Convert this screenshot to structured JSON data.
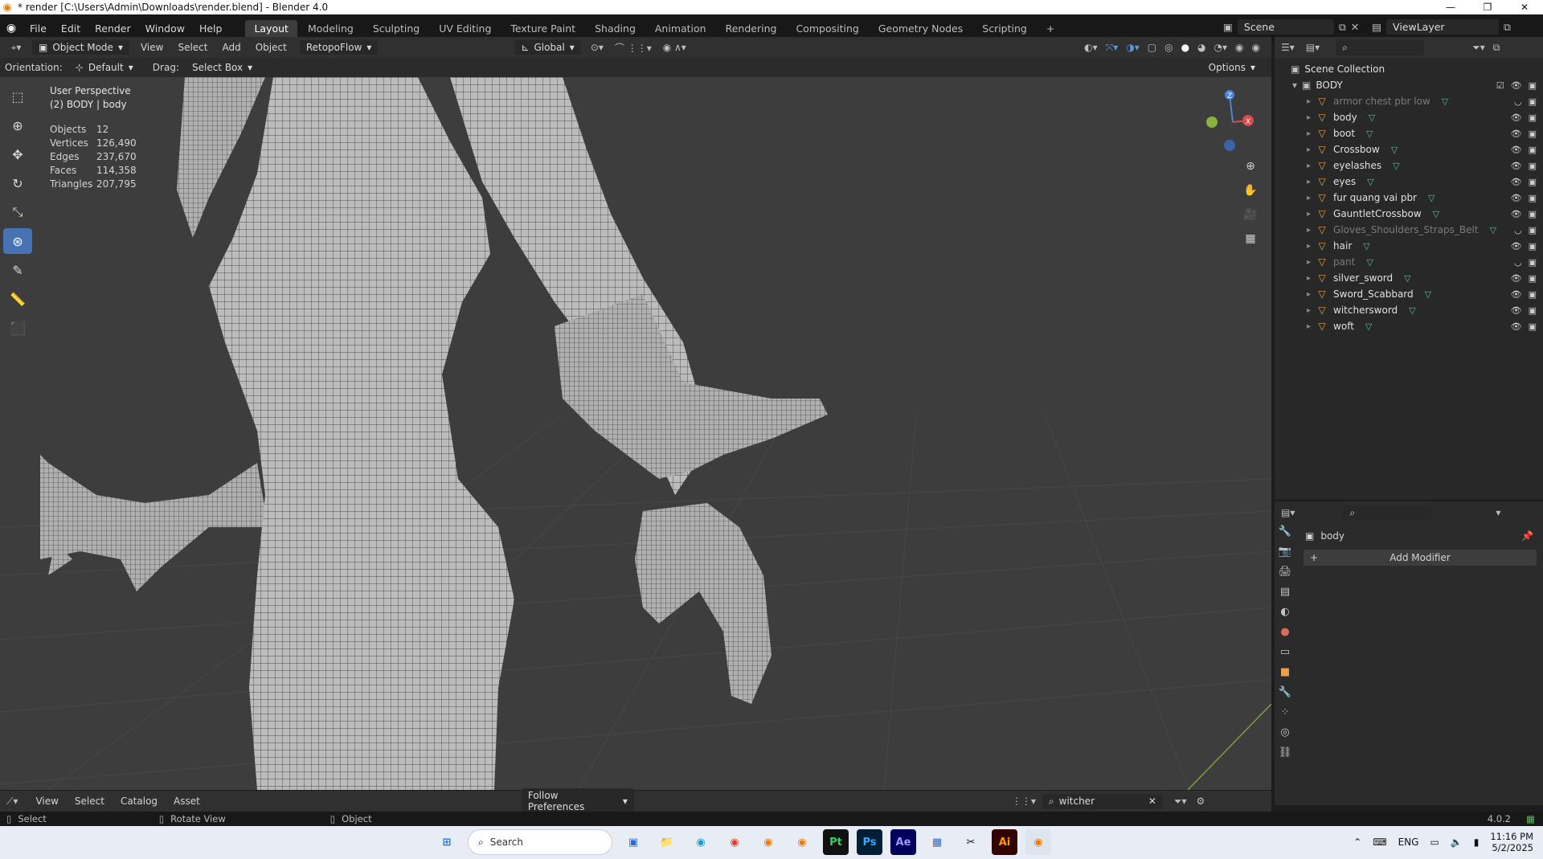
{
  "window": {
    "title": "* render [C:\\Users\\Admin\\Downloads\\render.blend] - Blender 4.0"
  },
  "menu": {
    "items": [
      "File",
      "Edit",
      "Render",
      "Window",
      "Help"
    ]
  },
  "workspaces": {
    "active": "Layout",
    "tabs": [
      "Layout",
      "Modeling",
      "Sculpting",
      "UV Editing",
      "Texture Paint",
      "Shading",
      "Animation",
      "Rendering",
      "Compositing",
      "Geometry Nodes",
      "Scripting"
    ]
  },
  "scene": {
    "name": "Scene",
    "view_layer": "ViewLayer"
  },
  "header": {
    "mode": "Object Mode",
    "menus": [
      "View",
      "Select",
      "Add",
      "Object",
      "RetopoFlow"
    ],
    "transform": "Global"
  },
  "header2": {
    "orientation_label": "Orientation:",
    "orientation_value": "Default",
    "drag_label": "Drag:",
    "drag_value": "Select Box",
    "options": "Options"
  },
  "viewport": {
    "perspective": "User Perspective",
    "object_info": "(2) BODY | body"
  },
  "stats": [
    {
      "label": "Objects",
      "value": "12"
    },
    {
      "label": "Vertices",
      "value": "126,490"
    },
    {
      "label": "Edges",
      "value": "237,670"
    },
    {
      "label": "Faces",
      "value": "114,358"
    },
    {
      "label": "Triangles",
      "value": "207,795"
    }
  ],
  "gizmo": {
    "x": "X",
    "y": "Y",
    "z": "Z"
  },
  "outliner": {
    "root": "Scene Collection",
    "collection": "BODY",
    "items": [
      {
        "name": "armor chest pbr low",
        "dim": true
      },
      {
        "name": "body",
        "dim": false
      },
      {
        "name": "boot",
        "dim": false
      },
      {
        "name": "Crossbow",
        "dim": false
      },
      {
        "name": "eyelashes",
        "dim": false
      },
      {
        "name": "eyes",
        "dim": false
      },
      {
        "name": "fur quang vai pbr",
        "dim": false
      },
      {
        "name": "GauntletCrossbow",
        "dim": false
      },
      {
        "name": "Gloves_Shoulders_Straps_Belt",
        "dim": true
      },
      {
        "name": "hair",
        "dim": false
      },
      {
        "name": "pant",
        "dim": true
      },
      {
        "name": "silver_sword",
        "dim": false
      },
      {
        "name": "Sword_Scabbard",
        "dim": false
      },
      {
        "name": "witchersword",
        "dim": false
      },
      {
        "name": "woft",
        "dim": false
      }
    ]
  },
  "properties": {
    "object_name": "body",
    "add_modifier": "Add Modifier"
  },
  "assetbar": {
    "menus": [
      "View",
      "Select",
      "Catalog",
      "Asset"
    ],
    "import": "Follow Preferences",
    "search_value": "witcher"
  },
  "statusbar": {
    "select": "Select",
    "rotate": "Rotate View",
    "object": "Object",
    "version": "4.0.2"
  },
  "taskbar": {
    "search_placeholder": "Search",
    "lang": "ENG",
    "time": "11:16 PM",
    "date": "5/2/2025"
  },
  "colors": {
    "accent": "#4772b3",
    "orange": "#e8a04a",
    "mesh_green": "#4fc48a",
    "bg": "#303030"
  }
}
